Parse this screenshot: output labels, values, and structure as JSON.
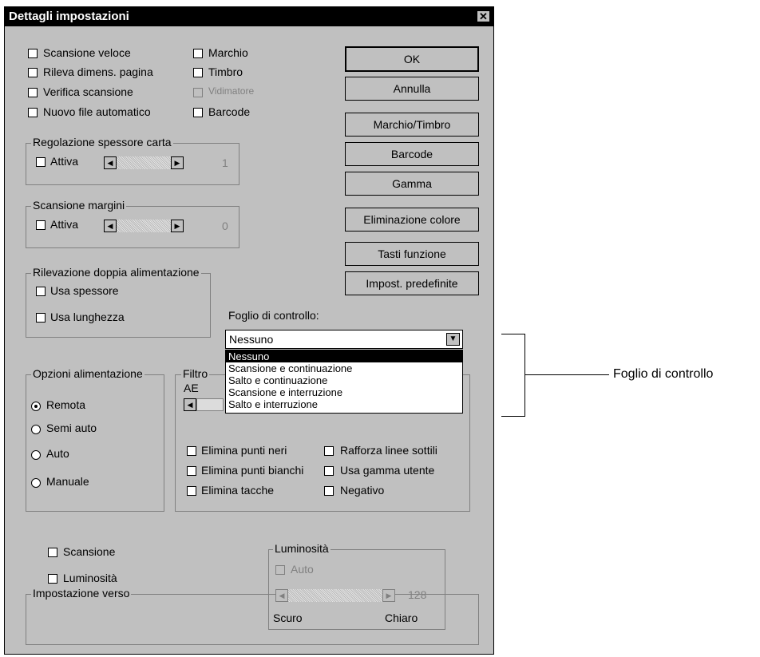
{
  "window": {
    "title": "Dettagli impostazioni",
    "close": "✕"
  },
  "options_col1": [
    "Scansione veloce",
    "Rileva dimens. pagina",
    "Verifica scansione",
    "Nuovo file automatico"
  ],
  "options_col2": [
    {
      "label": "Marchio",
      "disabled": false
    },
    {
      "label": "Timbro",
      "disabled": false
    },
    {
      "label": "Vidimatore",
      "disabled": true
    },
    {
      "label": "Barcode",
      "disabled": false
    }
  ],
  "buttons": [
    "OK",
    "Annulla",
    "Marchio/Timbro",
    "Barcode",
    "Gamma",
    "Eliminazione colore",
    "Tasti funzione",
    "Impost. predefinite"
  ],
  "paper_thickness": {
    "title": "Regolazione spessore carta",
    "enable": "Attiva",
    "value": "1"
  },
  "margin_scan": {
    "title": "Scansione margini",
    "enable": "Attiva",
    "value": "0"
  },
  "double_feed": {
    "title": "Rilevazione doppia alimentazione",
    "use_thickness": "Usa spessore",
    "use_length": "Usa lunghezza"
  },
  "control_sheet": {
    "label": "Foglio di controllo:",
    "selected": "Nessuno",
    "options": [
      "Nessuno",
      "Scansione e continuazione",
      "Salto e continuazione",
      "Scansione e interruzione",
      "Salto e interruzione"
    ],
    "callout": "Foglio di controllo"
  },
  "feed_options": {
    "title": "Opzioni alimentazione",
    "items": [
      "Remota",
      "Semi auto",
      "Auto",
      "Manuale"
    ],
    "selected": "Remota"
  },
  "filter": {
    "title": "Filtro",
    "ae_label": "AE",
    "col1": [
      "Elimina punti neri",
      "Elimina punti bianchi",
      "Elimina tacche"
    ],
    "col2": [
      "Rafforza linee sottili",
      "Usa gamma utente",
      "Negativo"
    ]
  },
  "backside": {
    "title": "Impostazione verso",
    "scan": "Scansione",
    "brightness_cb": "Luminosità",
    "brightness_group": {
      "title": "Luminosità",
      "auto": "Auto",
      "value": "128",
      "dark": "Scuro",
      "light": "Chiaro"
    }
  },
  "icons": {
    "left_arrow": "◀",
    "right_arrow": "▶",
    "dropdown_arrow": "▼"
  },
  "colors": {
    "face": "#c0c0c0",
    "titlebar": "#000000",
    "highlight": "#000000"
  }
}
